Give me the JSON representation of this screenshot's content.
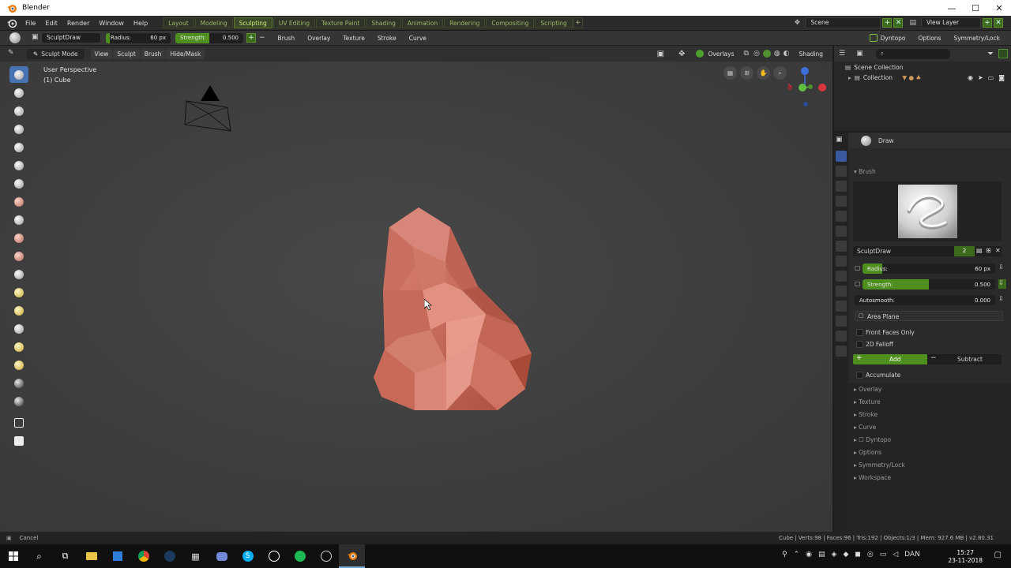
{
  "window": {
    "title": "Blender",
    "controls": [
      "—",
      "☐",
      "✕"
    ]
  },
  "menu": [
    "File",
    "Edit",
    "Render",
    "Window",
    "Help"
  ],
  "workspaces": [
    {
      "label": "Layout",
      "active": false
    },
    {
      "label": "Modeling",
      "active": false
    },
    {
      "label": "Sculpting",
      "active": true
    },
    {
      "label": "UV Editing",
      "active": false
    },
    {
      "label": "Texture Paint",
      "active": false
    },
    {
      "label": "Shading",
      "active": false
    },
    {
      "label": "Animation",
      "active": false
    },
    {
      "label": "Rendering",
      "active": false
    },
    {
      "label": "Compositing",
      "active": false
    },
    {
      "label": "Scripting",
      "active": false
    }
  ],
  "scene": "Scene",
  "view_layer": "View Layer",
  "tool_settings": {
    "brush_name": "SculptDraw",
    "radius_label": "Radius:",
    "radius_value": "60 px",
    "strength_label": "Strength:",
    "strength_value": "0.500",
    "strength_fraction": 0.5,
    "menus": [
      "Brush",
      "Overlay",
      "Texture",
      "Stroke",
      "Curve"
    ],
    "right": [
      "Dyntopo",
      "Options",
      "Symmetry/Lock"
    ]
  },
  "viewport_header": {
    "mode": "Sculpt Mode",
    "menus": [
      "View",
      "Sculpt",
      "Brush",
      "Hide/Mask"
    ],
    "overlays": "Overlays",
    "shading": "Shading"
  },
  "viewport": {
    "perspective": "User Perspective",
    "object": "(1) Cube"
  },
  "tools": [
    "draw",
    "clay",
    "clay-strips",
    "layer",
    "inflate",
    "blob",
    "crease",
    "smooth",
    "flatten",
    "fill",
    "scrape",
    "pinch",
    "grab",
    "snake-hook",
    "thumb",
    "nudge",
    "rotate",
    "simplify",
    "mask",
    "box-mask",
    "box-hide"
  ],
  "outliner": {
    "scene_collection": "Scene Collection",
    "collection": "Collection"
  },
  "properties": {
    "tool_name": "Draw",
    "brush_section": "Brush",
    "brush_datablock": "SculptDraw",
    "users": "2",
    "radius_label": "Radius:",
    "radius_value": "60 px",
    "radius_fraction": 0.15,
    "strength_label": "Strength:",
    "strength_value": "0.500",
    "strength_fraction": 0.5,
    "autosmooth_label": "Autosmooth:",
    "autosmooth_value": "0.000",
    "plane": "Area Plane",
    "front_faces": "Front Faces Only",
    "falloff_2d": "2D Falloff",
    "add": "Add",
    "subtract": "Subtract",
    "accumulate": "Accumulate",
    "sections": [
      "Overlay",
      "Texture",
      "Stroke",
      "Curve",
      "Dyntopo",
      "Options",
      "Symmetry/Lock",
      "Workspace"
    ]
  },
  "status": {
    "left": "Cancel",
    "right": "Cube | Verts:98 | Faces:96 | Tris:192 | Objects:1/3 | Mem: 927.6 MB | v2.80.31"
  },
  "taskbar": {
    "language": "DAN",
    "time": "15:27",
    "date": "23-11-2018"
  },
  "colors": {
    "accent": "#4772b3",
    "green": "#4f8f1f",
    "mesh": "#c8695a"
  }
}
